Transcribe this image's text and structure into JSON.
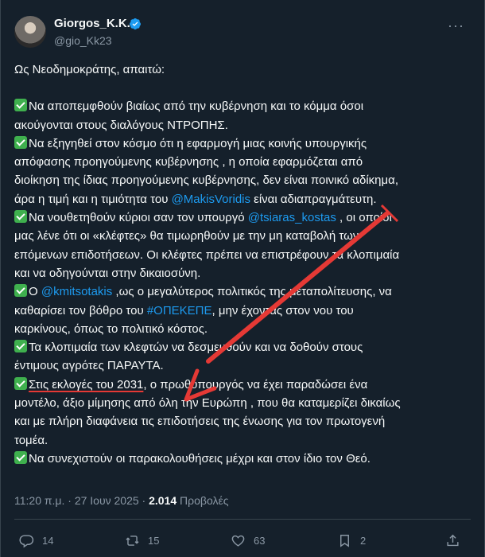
{
  "author": {
    "name": "Giorgos_K.K.",
    "handle": "@gio_Kk23",
    "more": "···"
  },
  "tweet": {
    "intro": "Ως Νεοδημοκράτης, απαιτώ:",
    "line1": "Να αποπεμφθούν βιαίως από την κυβέρνηση και το κόμμα όσοι",
    "line2": "ακούγονται στους διαλόγους ΝΤΡΟΠΗΣ.",
    "line3": "Να εξηγηθεί στον κόσμο ότι η εφαρμογή μιας κοινής υπουργικής",
    "line4": "απόφασης προηγούμενης κυβέρνησης , η οποία εφαρμόζεται από",
    "line5": "διοίκηση της ίδιας προηγούμενης κυβέρνησης, δεν είναι ποινικό αδίκημα,",
    "line6_a": "άρα η τιμή και η τιμιότητα του ",
    "line6_mention": "@MakisVoridis",
    "line6_b": " είναι αδιαπραγμάτευτη.",
    "line7_a": "Να νουθετηθούν κύριοι σαν τον υπουργό ",
    "line7_mention": "@tsiaras_kostas",
    "line7_b": " , οι οποίοι",
    "line8": "μας λένε ότι οι «κλέφτες» θα τιμωρηθούν με την μη καταβολή των",
    "line9": "επόμενων επιδοτήσεων. Οι κλέφτες πρέπει να επιστρέφουν τα κλοπιμαία",
    "line10": "και να οδηγούνται στην δικαιοσύνη.",
    "line11_a": "Ο ",
    "line11_mention": "@kmitsotakis",
    "line11_b": " ,ως ο μεγαλύτερος πολιτικός της μεταπολίτευσης, να",
    "line12_a": "καθαρίσει τον βόθρο του ",
    "line12_hashtag": "#ΟΠΕΚΕΠΕ",
    "line12_b": ", μην έχοντας στον νου του",
    "line13": "καρκίνους, όπως το πολιτικό κόστος.",
    "line14": "Τα κλοπιμαία των κλεφτών να δεσμευθούν και να δοθούν στους",
    "line15": "έντιμους αγρότες ΠΑΡΑΥΤΑ.",
    "line16_a": "Στις εκλογές του 2031",
    "line16_b": ", ο πρωθυπουργός να έχει παραδώσει ένα",
    "line17": "μοντέλο, άξιο μίμησης από όλη την Ευρώπη , που θα καταμερίζει δικαίως",
    "line18": "και με πλήρη διαφάνεια τις επιδοτήσεις της ένωσης για τον πρωτογενή",
    "line19": "τομέα.",
    "line20": "Να συνεχιστούν οι παρακολουθήσεις μέχρι και στον ίδιο τον Θεό."
  },
  "meta": {
    "time": "11:20 π.μ. · 27 Ιουν 2025 · ",
    "views_count": "2.014",
    "views_label": " Προβολές"
  },
  "actions": {
    "replies": "14",
    "reposts": "15",
    "likes": "63",
    "bookmarks": "2"
  },
  "colors": {
    "background": "#15202b",
    "text": "#f7f9f9",
    "muted": "#8b98a5",
    "link": "#1d9bf0",
    "annotation": "#e53935",
    "check": "#3fb04e"
  },
  "icons": [
    "verified-icon",
    "more-icon",
    "check-icon",
    "reply-icon",
    "repost-icon",
    "like-icon",
    "bookmark-icon",
    "share-icon"
  ]
}
